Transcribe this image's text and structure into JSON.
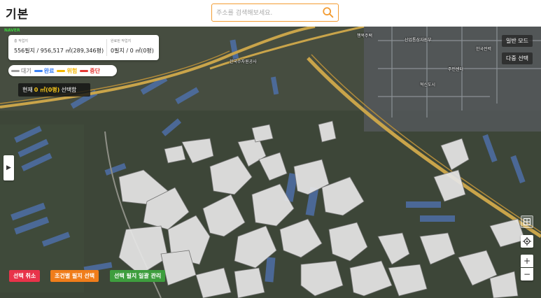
{
  "header": {
    "title": "기본",
    "search_placeholder": "주소를 검색해보세요."
  },
  "map": {
    "provider_logo": "NAVER",
    "stats": {
      "total_label": "총 작업지",
      "total_value": "556필지 / 956,517 ㎡(289,346평)",
      "done_label": "완료된 작업지",
      "done_value": "0필지 / 0 ㎡(0평)"
    },
    "legend": [
      {
        "label": "대기",
        "color": "#9e9e9e"
      },
      {
        "label": "완료",
        "color": "#3b82f6"
      },
      {
        "label": "위험",
        "color": "#f5b800"
      },
      {
        "label": "중단",
        "color": "#e53935"
      }
    ],
    "selection": {
      "prefix": "현재",
      "area": "0 ㎡(0평)",
      "suffix": "선택함"
    },
    "view_buttons": {
      "normal": "일반 모드",
      "multi": "다중 선택"
    },
    "controls": {
      "panel_toggle": "▶",
      "zoom_in": "+",
      "zoom_out": "−"
    },
    "actions": {
      "cancel": "선택 취소",
      "condition": "조건별 필지 선택",
      "bulk": "선택 필지 일괄 관리"
    },
    "place_labels": [
      "한국수자원공사",
      "산업통상자원부",
      "행복주택",
      "주민센터",
      "한국전력",
      "혁신도시"
    ]
  },
  "colors": {
    "accent": "#f39c32",
    "parcel_fill": "#e6e6e6",
    "road": "#c9a44a"
  }
}
